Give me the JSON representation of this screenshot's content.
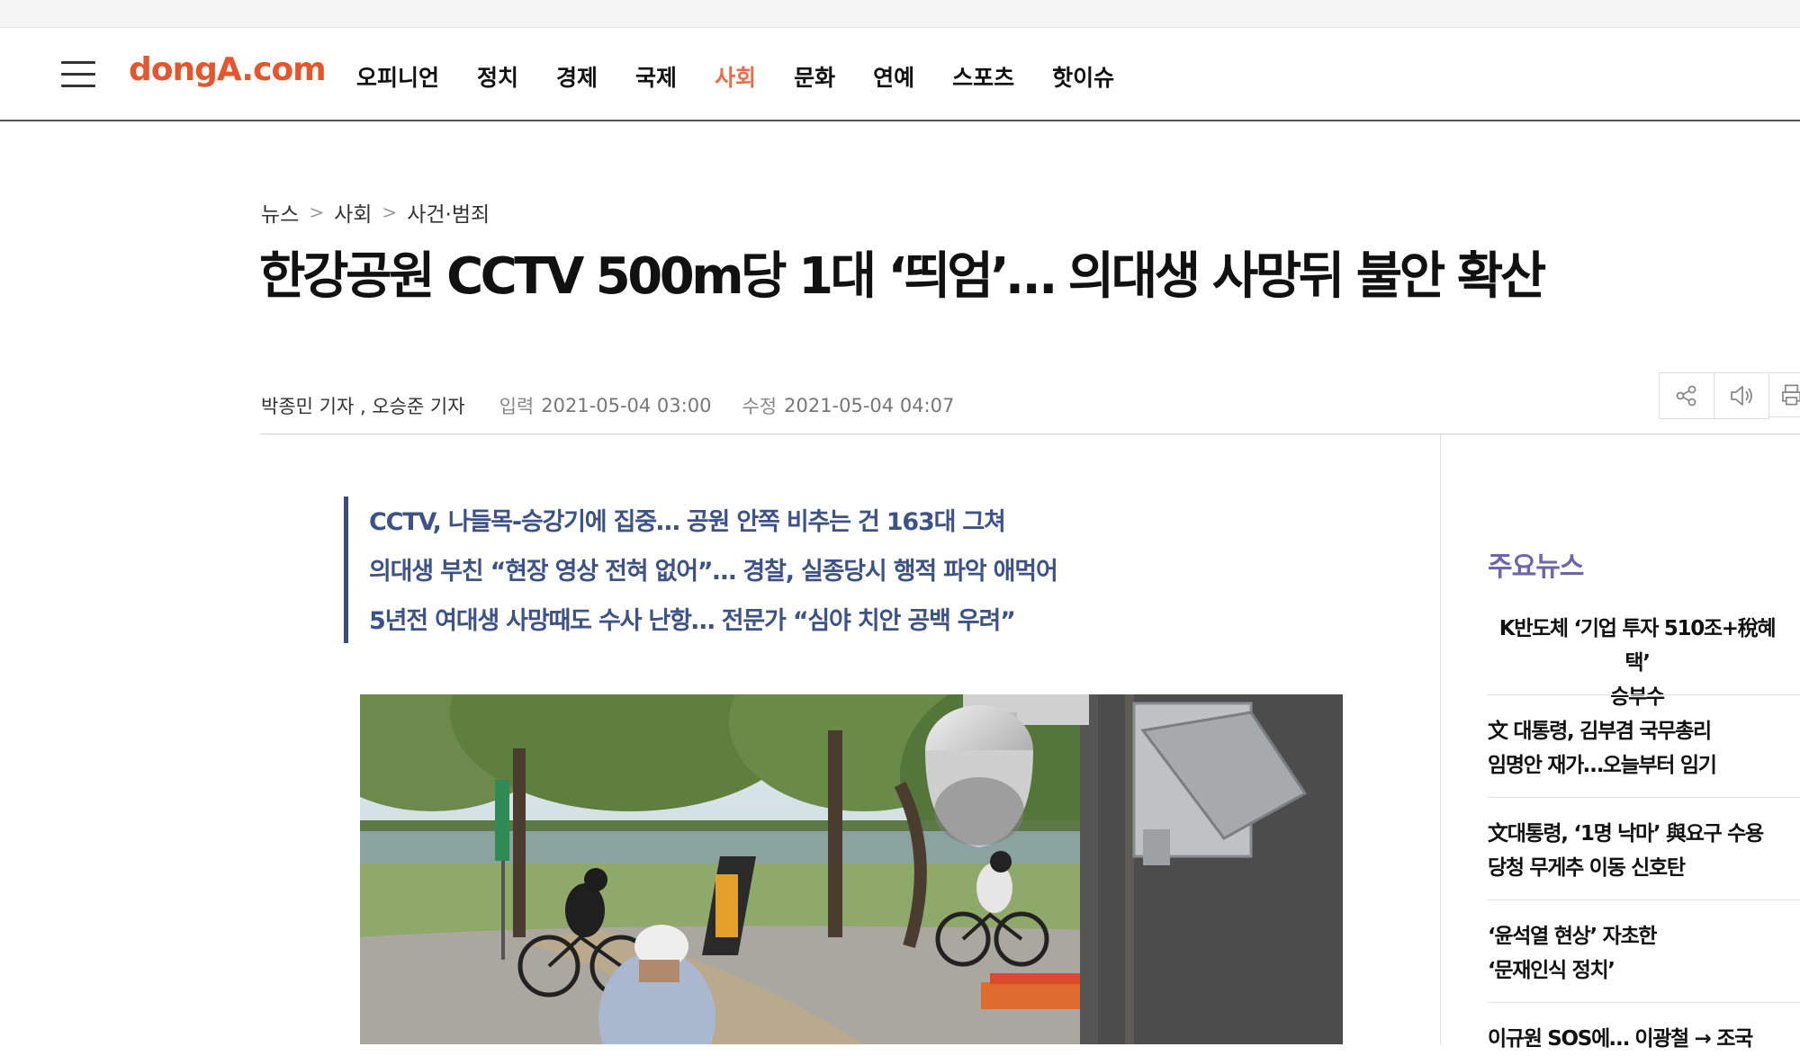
{
  "header": {
    "logo": "dongA.com",
    "nav": [
      "오피니언",
      "정치",
      "경제",
      "국제",
      "사회",
      "문화",
      "연예",
      "스포츠",
      "핫이슈"
    ],
    "active_nav": "사회",
    "accent_color": "#ec6c4a",
    "menu_icon": "hamburger-menu-icon"
  },
  "article": {
    "breadcrumb": [
      "뉴스",
      "사회",
      "사건·범죄"
    ],
    "breadcrumb_separator": ">",
    "headline": "한강공원 CCTV 500m당 1대 ‘띄엄’… 의대생 사망뒤 불안 확산",
    "authors": "박종민 기자 , 오승준 기자",
    "input_label": "입력",
    "input_date": "2021-05-04 03:00",
    "modified_label": "수정",
    "modified_date": "2021-05-04 04:07",
    "tools": [
      "share-icon",
      "speaker-icon",
      "print-icon"
    ],
    "summary": [
      "CCTV, 나들목-승강기에 집중… 공원 안쪽 비추는 건 163대 그쳐",
      "의대생 부친 “현장 영상 전혀 없어”… 경찰, 실종당시 행적 파악 애먹어",
      "5년전 여대생 사망때도 수사 난항… 전문가 “심야 치안 공백 우려”"
    ],
    "summary_color": "#3d5286"
  },
  "sidebar": {
    "title": "주요뉴스",
    "title_color": "#6f65ad",
    "items": [
      {
        "line1": "K반도체 ‘기업 투자 510조+稅혜택’",
        "line2": "승부수"
      },
      {
        "line1": "文 대통령, 김부겸 국무총리",
        "line2": "임명안 재가…오늘부터 임기"
      },
      {
        "line1": "文대통령, ‘1명 낙마’ 與요구 수용",
        "line2": "당청 무게추 이동 신호탄"
      },
      {
        "line1": "‘윤석열 현상’ 자초한",
        "line2": "‘문재인식 정치’"
      },
      {
        "line1": "이규원 SOS에… 이광철 → 조국",
        "line2": ""
      }
    ]
  }
}
